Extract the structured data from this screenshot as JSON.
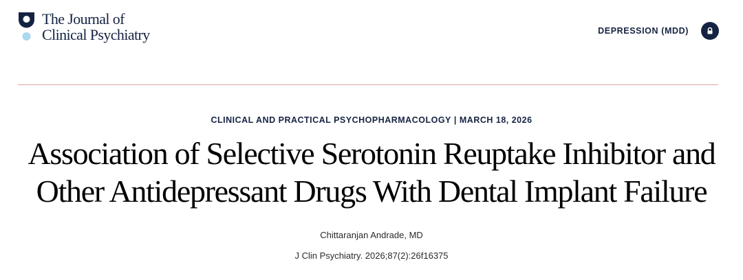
{
  "header": {
    "logo": {
      "line1": "The Journal of",
      "line2": "Clinical Psychiatry",
      "icon": "journal-logo-icon"
    },
    "topic_link": "DEPRESSION (MDD)",
    "lock_icon": "lock-icon"
  },
  "colors": {
    "navy": "#152342",
    "logo_dot": "#a9d8ef",
    "divider": "#d9a6a8"
  },
  "article": {
    "section": "CLINICAL AND PRACTICAL PSYCHOPHARMACOLOGY",
    "separator": "|",
    "date": "MARCH 18, 2026",
    "title": "Association of Selective Serotonin Reuptake Inhibitor and Other Antidepressant Drugs With Dental Implant Failure",
    "author": "Chittaranjan Andrade, MD",
    "citation": "J Clin Psychiatry. 2026;87(2):26f16375"
  }
}
